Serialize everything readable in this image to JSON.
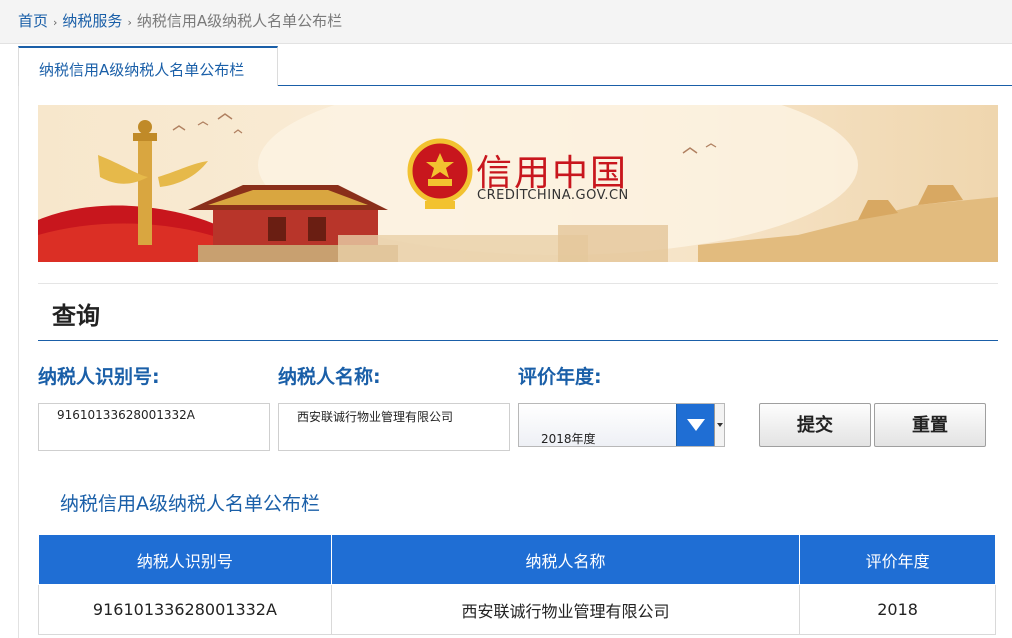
{
  "breadcrumb": {
    "home": "首页",
    "section": "纳税服务",
    "current": "纳税信用A级纳税人名单公布栏",
    "sep": "›"
  },
  "tab": {
    "label": "纳税信用A级纳税人名单公布栏"
  },
  "banner": {
    "logo_title": "信用中国",
    "logo_domain": "CREDITCHINA.GOV.CN"
  },
  "query": {
    "title": "查询",
    "labels": {
      "taxpayer_id": "纳税人识别号:",
      "taxpayer_name": "纳税人名称:",
      "year": "评价年度:"
    },
    "values": {
      "taxpayer_id": "91610133628001332A",
      "taxpayer_name": "西安联诚行物业管理有限公司",
      "year": "2018年度"
    },
    "buttons": {
      "submit": "提交",
      "reset": "重置"
    }
  },
  "results": {
    "title": "纳税信用A级纳税人名单公布栏",
    "columns": [
      "纳税人识别号",
      "纳税人名称",
      "评价年度"
    ],
    "rows": [
      [
        "91610133628001332A",
        "西安联诚行物业管理有限公司",
        "2018"
      ]
    ]
  },
  "colors": {
    "accent": "#1a5fa8",
    "table_header": "#1f6ed4",
    "emblem_red": "#c8161d"
  }
}
